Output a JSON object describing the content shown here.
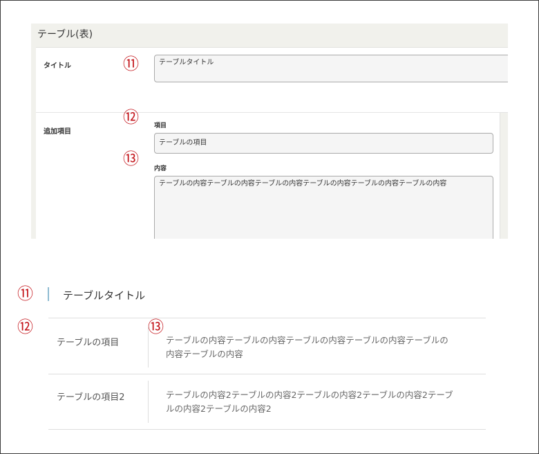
{
  "admin": {
    "section_title": "テーブル(表)",
    "title_label": "タイトル",
    "title_value": "テーブルタイトル",
    "extra_label": "追加項目",
    "item_label": "項目",
    "item_value": "テーブルの項目",
    "content_label": "内容",
    "content_value": "テーブルの内容テーブルの内容テーブルの内容テーブルの内容テーブルの内容テーブルの内容"
  },
  "markers": {
    "m11": "⑪",
    "m12": "⑫",
    "m13": "⑬"
  },
  "preview": {
    "title": "テーブルタイトル",
    "rows": [
      {
        "head": "テーブルの項目",
        "body_line1": "テーブルの内容テーブルの内容テーブルの内容テーブルの内容テーブルの",
        "body_line2": "内容テーブルの内容"
      },
      {
        "head": "テーブルの項目2",
        "body_line1": "テーブルの内容2テーブルの内容2テーブルの内容2テーブルの内容2テーブ",
        "body_line2": "ルの内容2テーブルの内容2"
      }
    ]
  },
  "colors": {
    "marker_red": "#c4161c",
    "title_accent": "#8fbcd2",
    "panel_bg": "#f1f1ec"
  }
}
